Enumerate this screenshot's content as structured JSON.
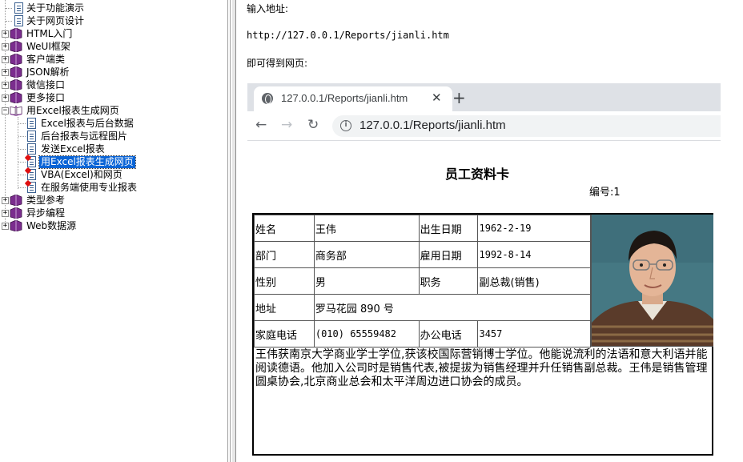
{
  "tree": {
    "items": [
      {
        "label": "关于功能演示",
        "kind": "page"
      },
      {
        "label": "关于网页设计",
        "kind": "page"
      },
      {
        "label": "HTML入门",
        "kind": "book"
      },
      {
        "label": "WeUI框架",
        "kind": "book"
      },
      {
        "label": "客户端类",
        "kind": "book"
      },
      {
        "label": "JSON解析",
        "kind": "book"
      },
      {
        "label": "微信接口",
        "kind": "book"
      },
      {
        "label": "更多接口",
        "kind": "book"
      },
      {
        "label": "用Excel报表生成网页",
        "kind": "book-open"
      },
      {
        "label": "Excel报表与后台数据",
        "kind": "page"
      },
      {
        "label": "后台报表与远程图片",
        "kind": "page"
      },
      {
        "label": "发送Excel报表",
        "kind": "page"
      },
      {
        "label": "用Excel报表生成网页",
        "kind": "page-star",
        "selected": true
      },
      {
        "label": "VBA(Excel)和网页",
        "kind": "page-star"
      },
      {
        "label": "在服务端使用专业报表",
        "kind": "page-star"
      },
      {
        "label": "类型参考",
        "kind": "book"
      },
      {
        "label": "异步编程",
        "kind": "book"
      },
      {
        "label": "Web数据源",
        "kind": "book"
      }
    ]
  },
  "content": {
    "intro_label": "输入地址:",
    "url_text": "http://127.0.0.1/Reports/jianli.htm",
    "result_label": "即可得到网页:"
  },
  "browser": {
    "tab_title": "127.0.0.1/Reports/jianli.htm",
    "tab_close": "✕",
    "new_tab": "+",
    "back": "←",
    "forward": "→",
    "reload": "↻",
    "info": "i",
    "address": "127.0.0.1/Reports/jianli.htm"
  },
  "card": {
    "title": "员工资料卡",
    "number_label": "编号:1",
    "rows": [
      [
        "姓名",
        "王伟",
        "出生日期",
        "1962-2-19"
      ],
      [
        "部门",
        "商务部",
        "雇用日期",
        "1992-8-14"
      ],
      [
        "性别",
        "男",
        "职务",
        "副总裁(销售)"
      ],
      [
        "地址",
        "罗马花园 890 号"
      ],
      [
        "家庭电话",
        "(010) 65559482",
        "办公电话",
        "3457"
      ]
    ],
    "description": "王伟获南京大学商业学士学位,获该校国际营销博士学位。他能说流利的法语和意大利语并能阅读德语。他加入公司时是销售代表,被提拔为销售经理并升任销售副总裁。王伟是销售管理圆桌协会,北京商业总会和太平洋周边进口协会的成员。"
  },
  "colors": {
    "selection": "#0a64d6",
    "book_purple": "#7b2d8e",
    "tab_strip": "#dee1e6",
    "omnibox": "#f1f3f4"
  }
}
